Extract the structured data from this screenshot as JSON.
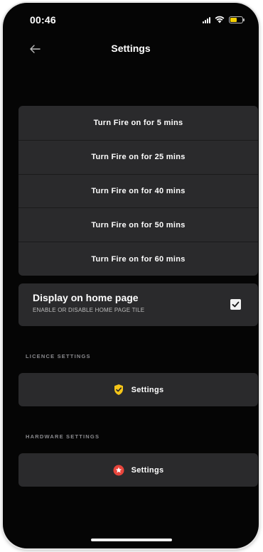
{
  "status_bar": {
    "time": "00:46",
    "colors": {
      "battery_fill": "#f5d000"
    }
  },
  "header": {
    "title": "Settings",
    "back_icon": "arrow-left-icon"
  },
  "timer_options": [
    {
      "label": "Turn Fire on for 5 mins"
    },
    {
      "label": "Turn Fire on for 25 mins"
    },
    {
      "label": "Turn Fire on for 40 mins"
    },
    {
      "label": "Turn Fire on for 50 mins"
    },
    {
      "label": "Turn Fire on for 60 mins"
    }
  ],
  "home_page": {
    "title": "Display on home page",
    "subtitle": "ENABLE OR DISABLE HOME PAGE TILE",
    "checked": true
  },
  "licence": {
    "section_label": "LICENCE SETTINGS",
    "button_label": "Settings",
    "icon": "shield-check-icon",
    "icon_color": "#f5c518"
  },
  "hardware": {
    "section_label": "HARDWARE SETTINGS",
    "button_label": "Settings",
    "icon": "star-badge-icon",
    "icon_color": "#e8453c"
  }
}
